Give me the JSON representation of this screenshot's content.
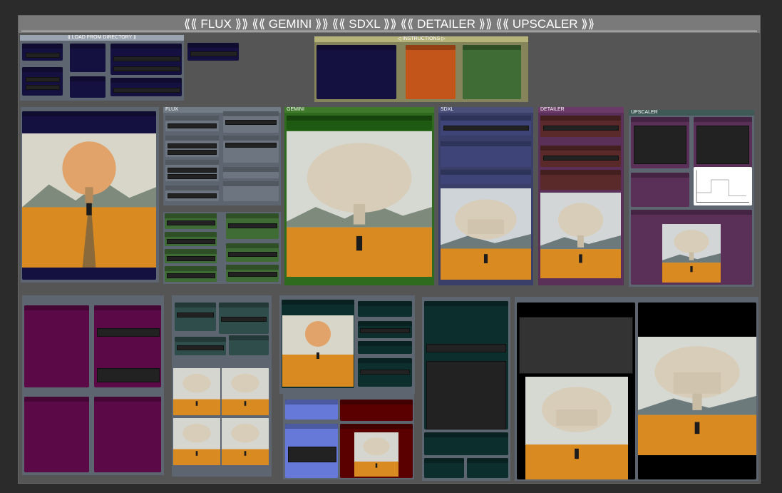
{
  "app": {
    "title": "⟪⟪ FLUX ⟫⟫ ⟪⟪ GEMINI ⟫⟫ ⟪⟪ SDXL ⟫⟫ ⟪⟪ DETAILER ⟫⟫ ⟪⟪ UPSCALER ⟫⟫"
  },
  "groups": {
    "load": {
      "label": "⟪ LOAD FROM DIRECTORY ⟫"
    },
    "instructions": {
      "label": "◁ INSTRUCTIONS ▷"
    },
    "flux": {
      "label": "FLUX"
    },
    "gemini": {
      "label": "GEMINI"
    },
    "sdxl": {
      "label": "SDXL"
    },
    "detailer": {
      "label": "DETAILER"
    },
    "upscaler": {
      "label": "UPSCALER"
    }
  },
  "colors": {
    "navy": "#14103f",
    "slate": "#5d6670",
    "green": "#3f6b35",
    "brightgreen": "#2f6b1f",
    "orange": "#c4551a",
    "purple": "#5b3058",
    "magenta": "#5c0a47",
    "teal": "#2f4d4a",
    "darkteal": "#0c2e2c",
    "maroon": "#5a0000",
    "periwinkle": "#6678d8",
    "brownred": "#5a2a2a",
    "indigo": "#3a3f6a"
  },
  "icons": [
    "mushroom-image-icon"
  ]
}
